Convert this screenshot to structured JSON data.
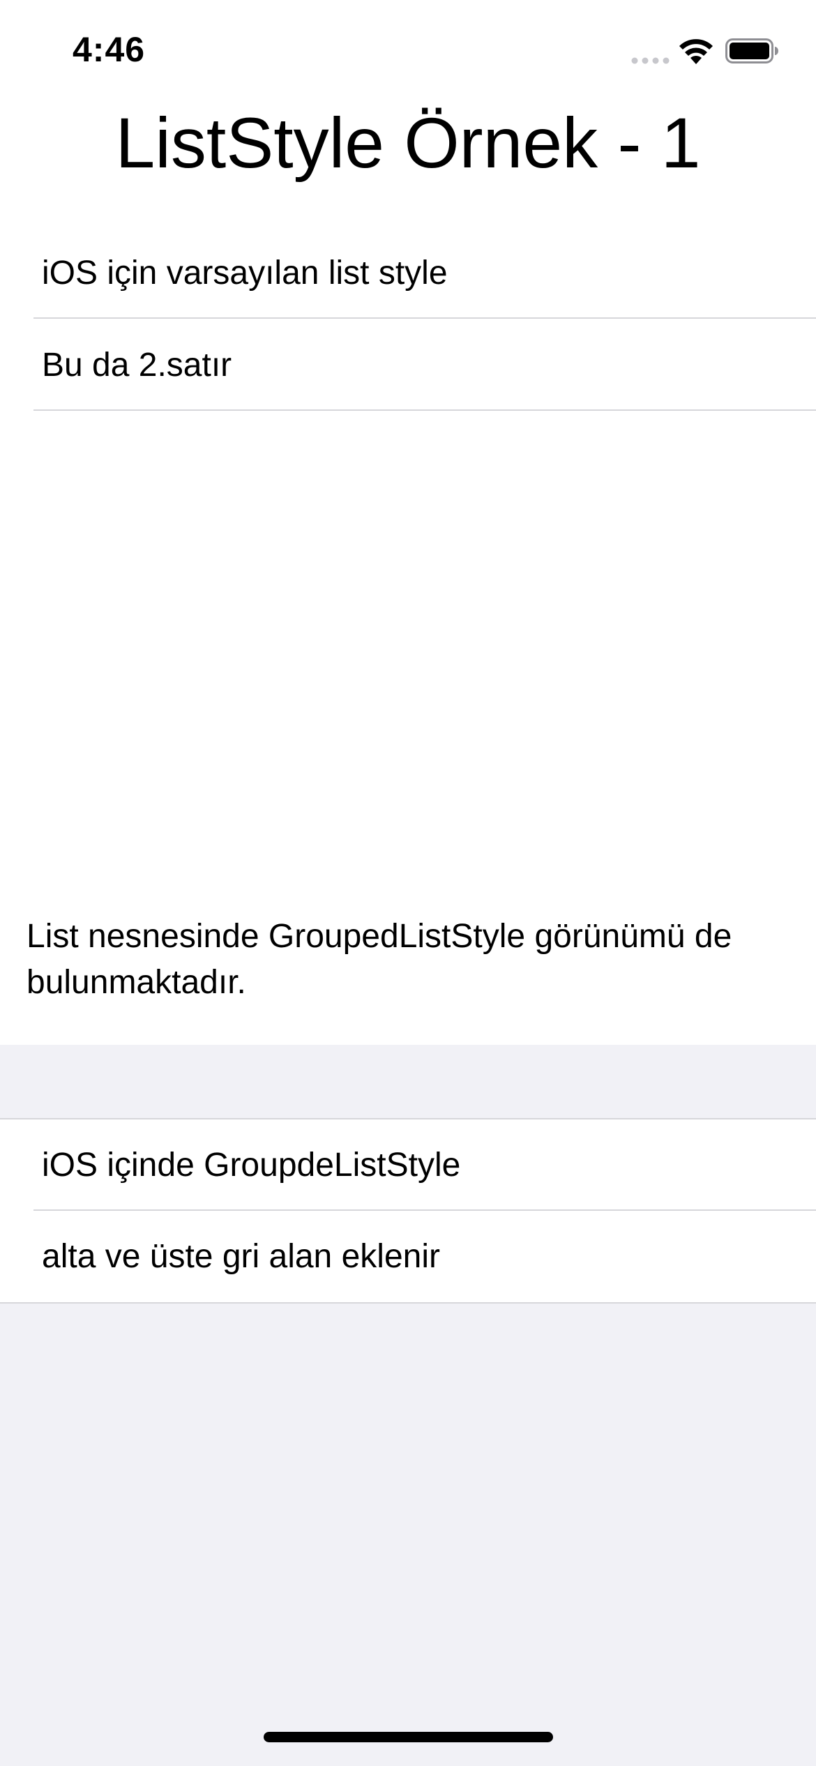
{
  "status_bar": {
    "time": "4:46",
    "icons": [
      "signal-icon",
      "wifi-icon",
      "battery-icon"
    ]
  },
  "title": "ListStyle Örnek - 1",
  "plain_list": {
    "items": [
      {
        "label": "iOS için varsayılan list style"
      },
      {
        "label": "Bu da 2.satır"
      }
    ]
  },
  "description": "List nesnesinde GroupedListStyle görünümü de bulunmaktadır.",
  "grouped_list": {
    "items": [
      {
        "label": "iOS içinde GroupdeListStyle"
      },
      {
        "label": "alta ve üste gri alan eklenir"
      }
    ]
  },
  "colors": {
    "background": "#ffffff",
    "grouped_background": "#f1f1f6",
    "separator": "#d6d6da",
    "text": "#000000"
  }
}
